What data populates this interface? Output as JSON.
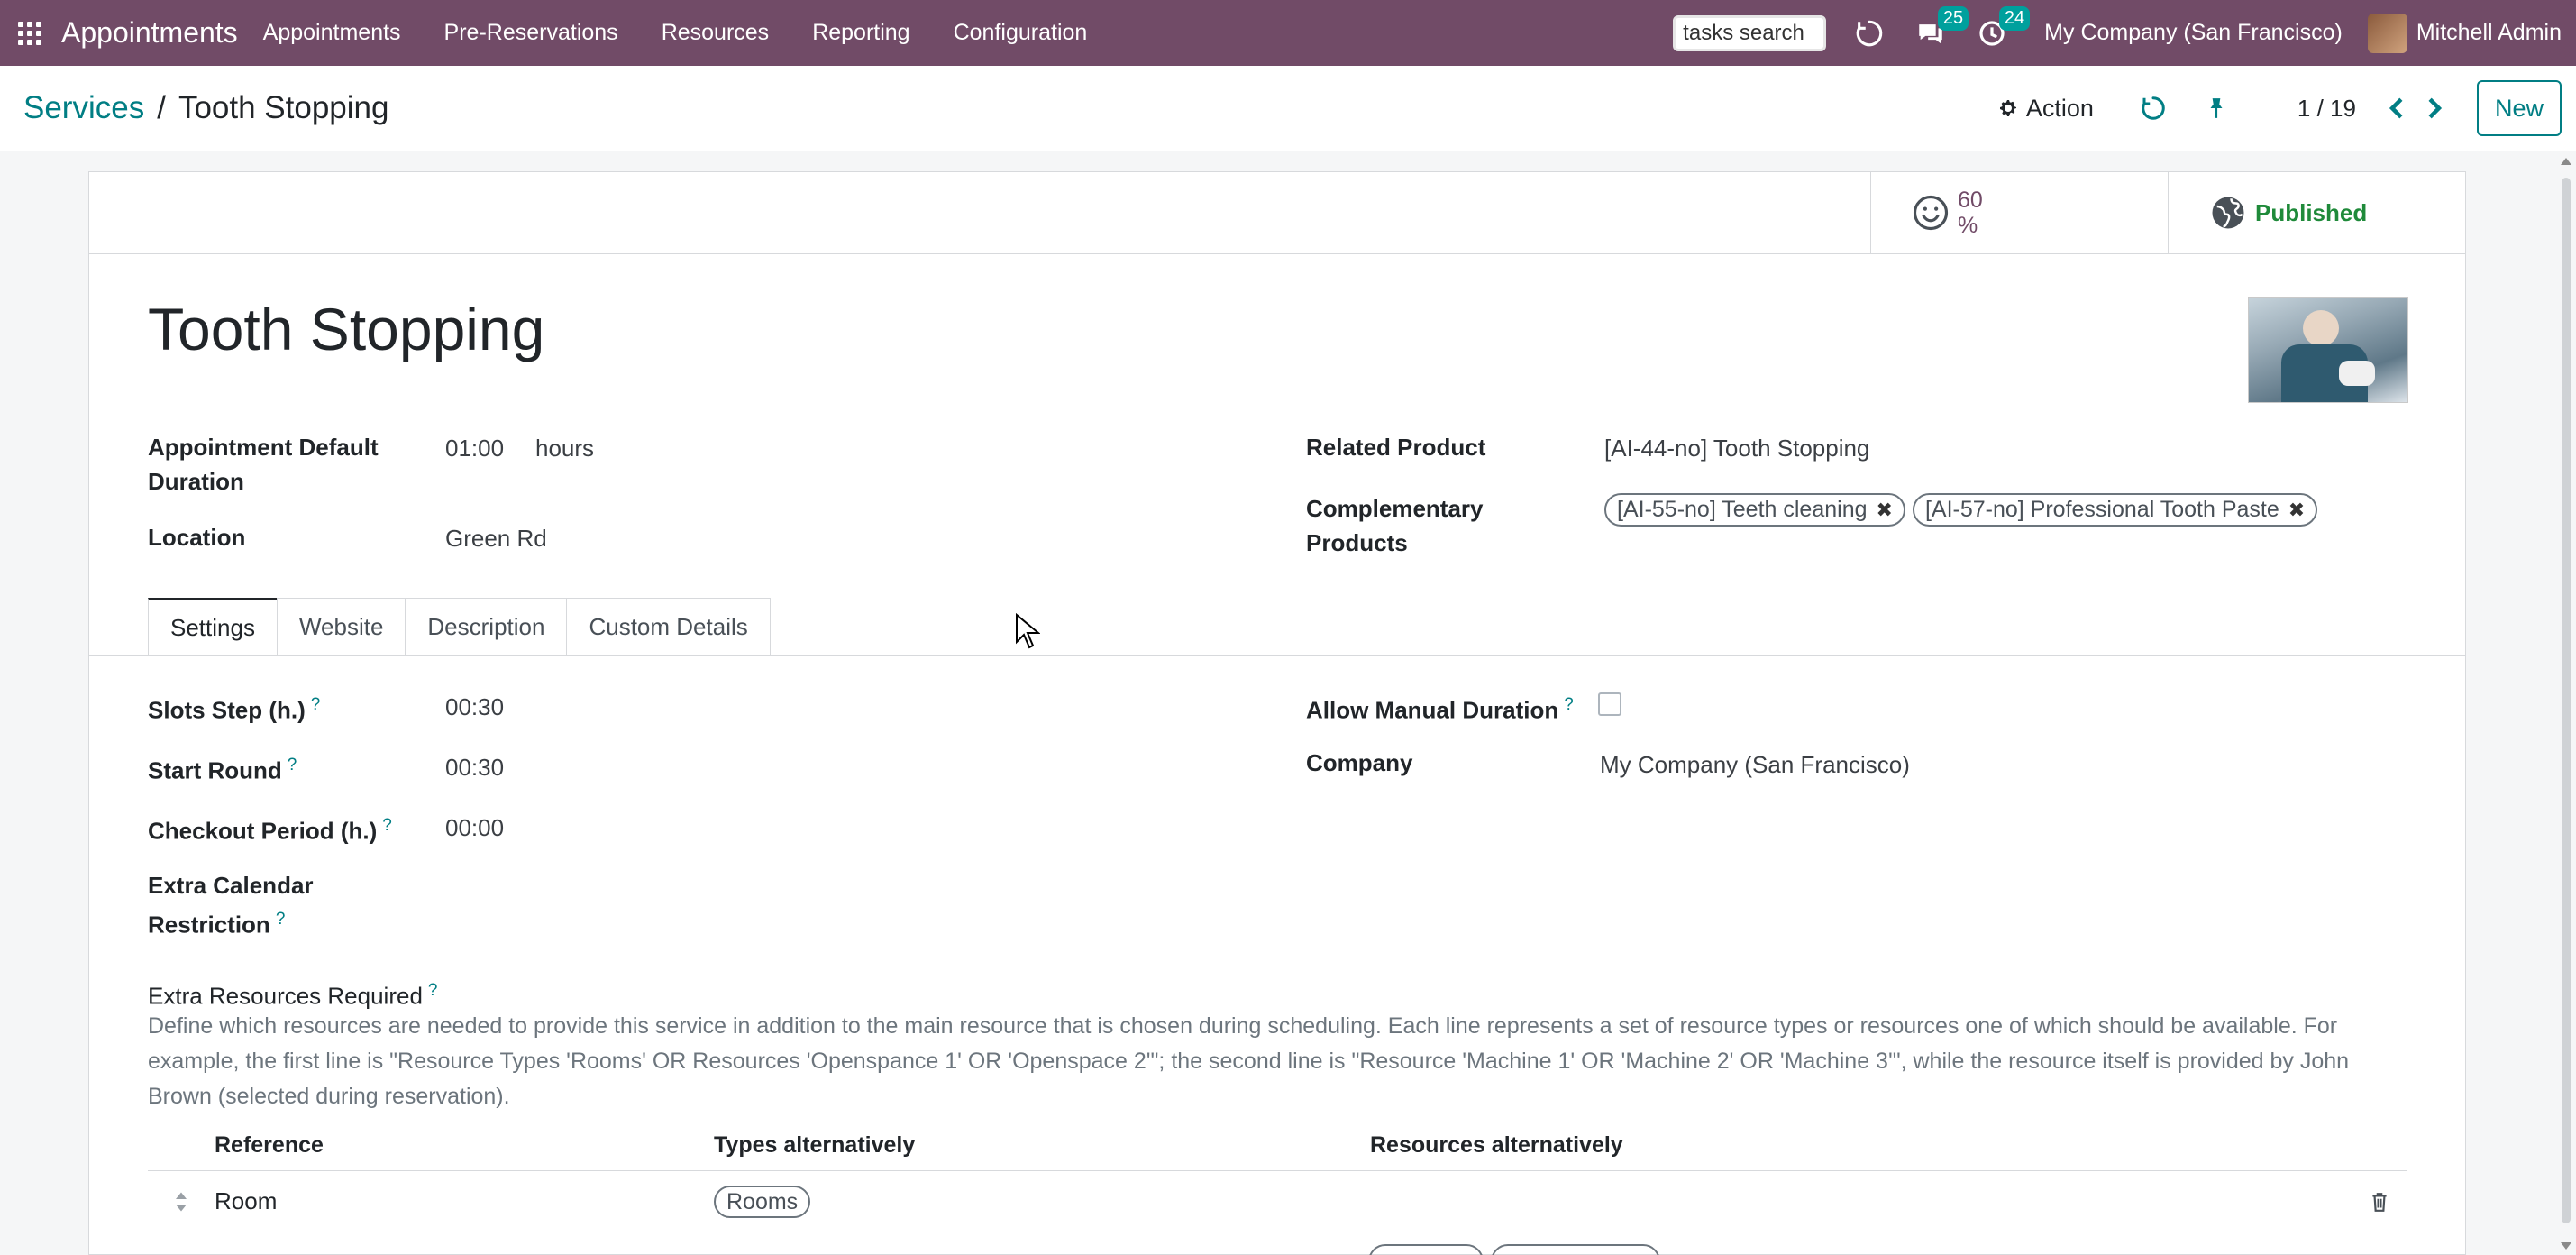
{
  "topbar": {
    "app_title": "Appointments",
    "menu": [
      "Appointments",
      "Pre-Reservations",
      "Resources",
      "Reporting",
      "Configuration"
    ],
    "tasks_search_placeholder": "tasks search",
    "messages_count": "25",
    "activities_count": "24",
    "company": "My Company (San Francisco)",
    "user": "Mitchell Admin",
    "brand_color": "#714B67"
  },
  "control_panel": {
    "breadcrumb_parent": "Services",
    "breadcrumb_sep": "/",
    "breadcrumb_current": "Tooth Stopping",
    "action_label": "Action",
    "pager": "1 / 19",
    "new_label": "New"
  },
  "button_box": {
    "rating_value": "60",
    "rating_unit": "%",
    "publish_label": "Published"
  },
  "record": {
    "title": "Tooth Stopping",
    "fields_left": [
      {
        "label": "Appointment Default Duration",
        "value": "01:00",
        "unit": "hours"
      },
      {
        "label": "Location",
        "value": "Green Rd"
      }
    ],
    "fields_right": [
      {
        "label": "Related Product",
        "value": "[AI-44-no] Tooth Stopping"
      },
      {
        "label": "Complementary Products",
        "tags": [
          "[AI-55-no] Teeth cleaning",
          "[AI-57-no] Professional Tooth Paste"
        ]
      }
    ]
  },
  "tabs": [
    "Settings",
    "Website",
    "Description",
    "Custom Details"
  ],
  "settings": {
    "left": [
      {
        "label": "Slots Step (h.)",
        "value": "00:30",
        "help": "?"
      },
      {
        "label": "Start Round",
        "value": "00:30",
        "help": "?"
      },
      {
        "label": "Checkout Period (h.)",
        "value": "00:00",
        "help": "?"
      },
      {
        "label": "Extra Calendar Restriction",
        "value": "",
        "help": "?"
      }
    ],
    "right": [
      {
        "label": "Allow Manual Duration",
        "help": "?"
      },
      {
        "label": "Company",
        "value": "My Company (San Francisco)"
      }
    ],
    "extra_resources_label": "Extra Resources Required",
    "extra_resources_help": "?",
    "extra_resources_desc": "Define which resources are needed to provide this service in addition to the main resource that is chosen during scheduling. Each line represents a set of resource types or resources one of which should be available. For example, the first line is \"Resource Types 'Rooms' OR Resources 'Openspance 1' OR 'Openspace 2'\"; the second line is \"Resource 'Machine 1' OR 'Machine 2' OR 'Machine 3'\", while the resource itself is provided by John Brown (selected during reservation).",
    "table": {
      "headers": [
        "Reference",
        "Types alternatively",
        "Resources alternatively"
      ],
      "rows": [
        {
          "reference": "Room",
          "types": [
            "Rooms"
          ],
          "resources": []
        }
      ]
    }
  }
}
